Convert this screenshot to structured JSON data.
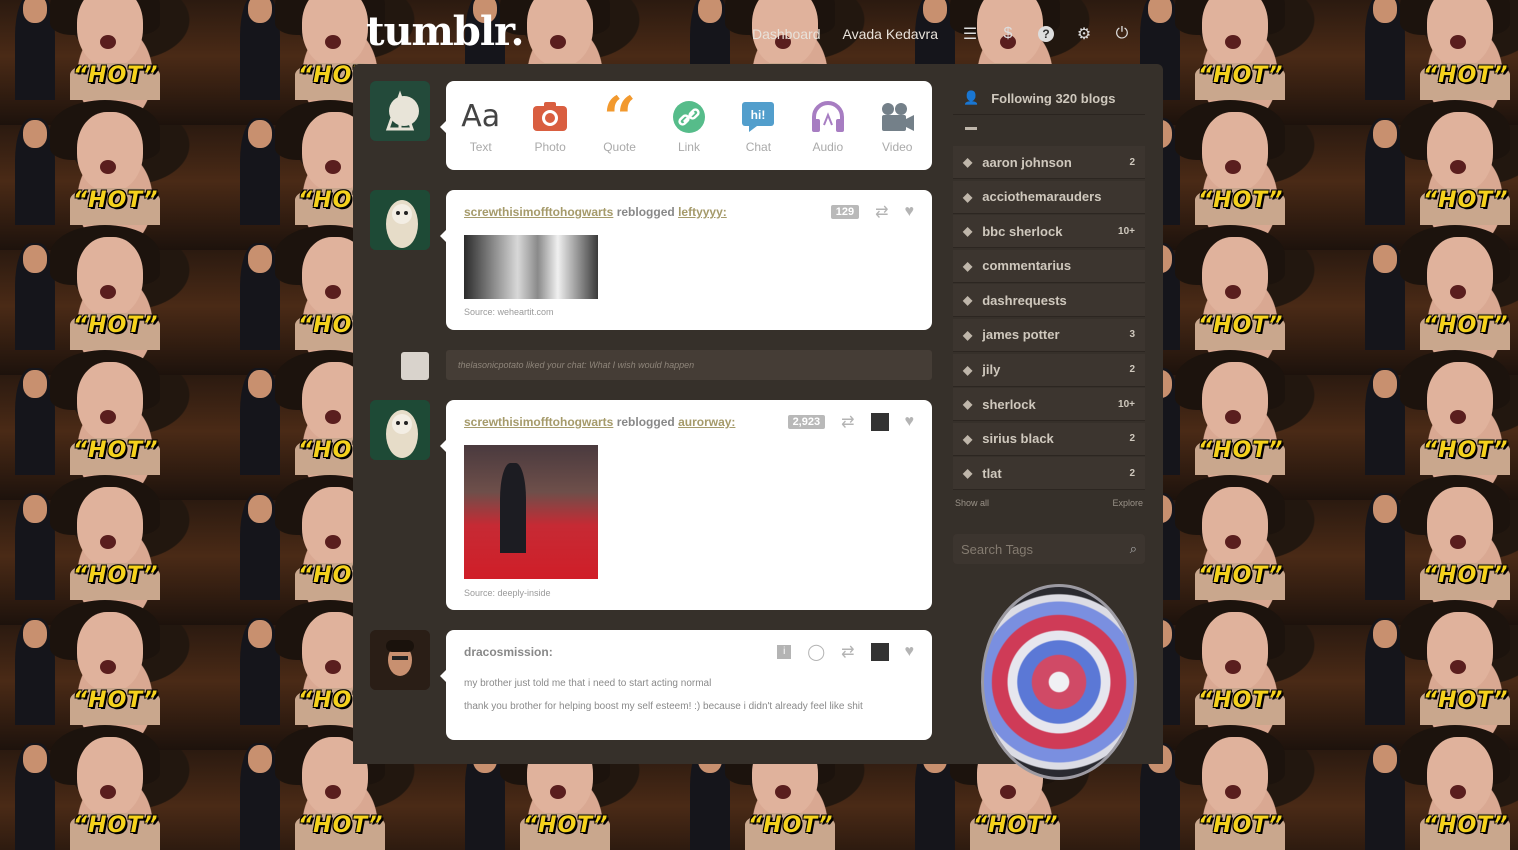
{
  "header": {
    "logo": "tumblr.",
    "nav_dashboard": "Dashboard",
    "nav_blog": "Avada Kedavra",
    "icons": [
      "list-icon",
      "dollar-icon",
      "help-icon",
      "gear-icon",
      "power-icon"
    ]
  },
  "post_types": [
    {
      "label": "Text",
      "icon": "text-icon",
      "color": "#444444"
    },
    {
      "label": "Photo",
      "icon": "camera-icon",
      "color": "#d95e40"
    },
    {
      "label": "Quote",
      "icon": "quote-icon",
      "color": "#f2992e"
    },
    {
      "label": "Link",
      "icon": "link-icon",
      "color": "#56bc8a"
    },
    {
      "label": "Chat",
      "icon": "chat-icon",
      "color": "#529ecc"
    },
    {
      "label": "Audio",
      "icon": "headphones-icon",
      "color": "#a77dc2"
    },
    {
      "label": "Video",
      "icon": "camera-video-icon",
      "color": "#748089"
    }
  ],
  "posts": [
    {
      "user": "screwthisimofftohogwarts",
      "action": "reblogged",
      "from": "leftyyyy:",
      "notes": "129",
      "source": "Source:  weheartit.com"
    },
    {
      "user": "screwthisimofftohogwarts",
      "action": "reblogged",
      "from": "aurorway:",
      "notes": "2,923",
      "source": "Source:  deeply-inside"
    },
    {
      "user": "dracosmission:",
      "body_line1": "my brother just told me that i need to start acting normal",
      "body_line2": "thank you brother for helping boost my self esteem! :) because i didn't already feel like shit"
    }
  ],
  "notice": "thelasonicpotato liked your chat: What I wish would happen",
  "sidebar": {
    "following": "Following 320 blogs",
    "tags": [
      {
        "name": "aaron johnson",
        "count": "2"
      },
      {
        "name": "acciothemarauders",
        "count": ""
      },
      {
        "name": "bbc sherlock",
        "count": "10+"
      },
      {
        "name": "commentarius",
        "count": ""
      },
      {
        "name": "dashrequests",
        "count": ""
      },
      {
        "name": "james potter",
        "count": "3"
      },
      {
        "name": "jily",
        "count": "2"
      },
      {
        "name": "sherlock",
        "count": "10+"
      },
      {
        "name": "sirius black",
        "count": "2"
      },
      {
        "name": "tlat",
        "count": "2"
      }
    ],
    "show_all": "Show all",
    "explore": "Explore",
    "search_placeholder": "Search Tags"
  },
  "bg_text": "“HOT”",
  "colors": {
    "panel": "#36302a",
    "tag_bg": "#3c352f",
    "link_gold": "#a59a6a"
  }
}
